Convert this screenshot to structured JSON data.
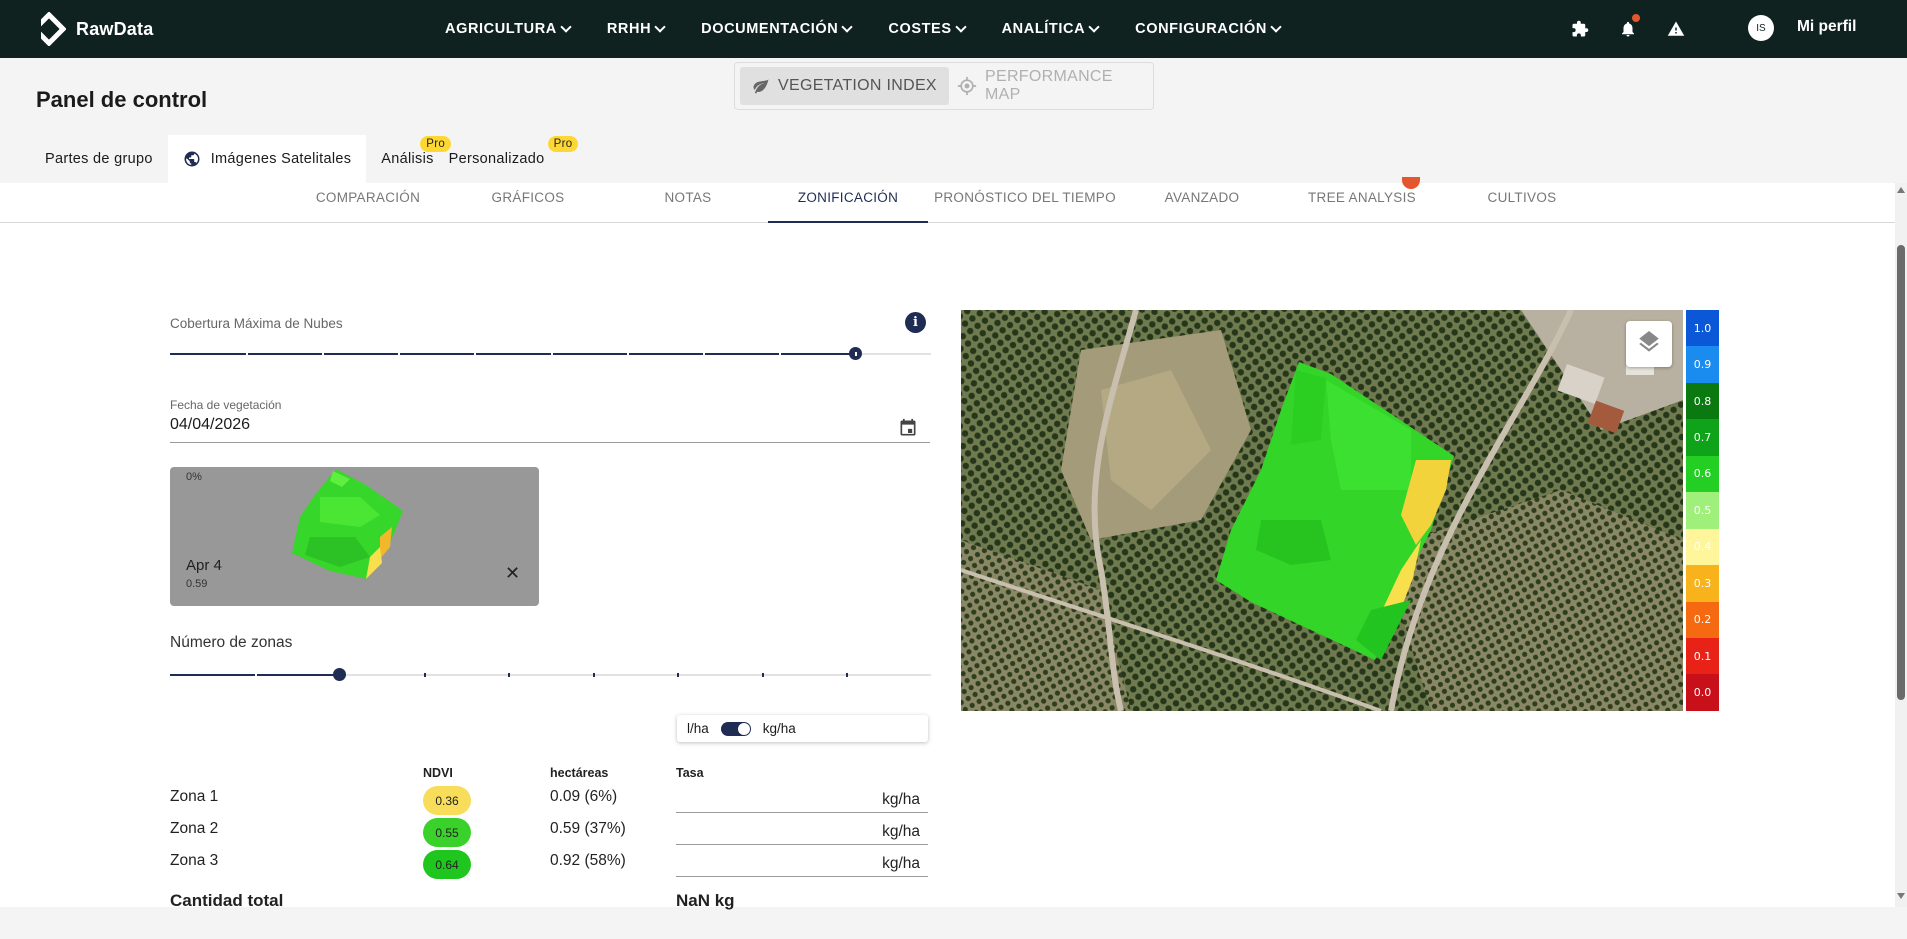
{
  "app": {
    "name": "RawData"
  },
  "nav": {
    "menu": [
      "AGRICULTURA",
      "RRHH",
      "DOCUMENTACIÓN",
      "COSTES",
      "ANALÍTICA",
      "CONFIGURACIÓN"
    ],
    "avatar_initials": "IS",
    "profile_label": "Mi perfil"
  },
  "page": {
    "title": "Panel de control"
  },
  "tabs": [
    {
      "label": "Partes de grupo"
    },
    {
      "label": "Imágenes Satelitales",
      "icon": "globe-icon",
      "active": true
    },
    {
      "label": "Análisis",
      "badge": "Pro"
    },
    {
      "label": "Personalizado",
      "badge": "Pro"
    }
  ],
  "subtabs": [
    "COMPARACIÓN",
    "GRÁFICOS",
    "NOTAS",
    "ZONIFICACIÓN",
    "PRONÓSTICO DEL TIEMPO",
    "AVANZADO",
    "TREE ANALYSIS",
    "CULTIVOS"
  ],
  "active_subtab": "ZONIFICACIÓN",
  "mode_toggle": {
    "vegetation": "VEGETATION INDEX",
    "performance": "PERFORMANCE MAP"
  },
  "controls": {
    "cloud_label": "Cobertura Máxima de Nubes",
    "cloud_value_fraction": 0.9,
    "date_label": "Fecha de vegetación",
    "date_value": "04/04/2026",
    "zones_label": "Número de zonas",
    "zones_value_fraction": 0.222
  },
  "thumbnail": {
    "cloud_pct": "0%",
    "date": "Apr 4",
    "value": "0.59"
  },
  "units": {
    "left": "l/ha",
    "right": "kg/ha"
  },
  "table": {
    "headers": {
      "ndvi": "NDVI",
      "hectares": "hectáreas",
      "rate": "Tasa"
    },
    "rows": [
      {
        "zone": "Zona 1",
        "ndvi": "0.36",
        "color": "#f7dd5a",
        "hectares": "0.09 (6%)",
        "unit": "kg/ha"
      },
      {
        "zone": "Zona 2",
        "ndvi": "0.55",
        "color": "#3ad12b",
        "hectares": "0.59 (37%)",
        "unit": "kg/ha"
      },
      {
        "zone": "Zona 3",
        "ndvi": "0.64",
        "color": "#1ec61e",
        "hectares": "0.92 (58%)",
        "unit": "kg/ha"
      }
    ],
    "total_label": "Cantidad total",
    "total_value": "NaN kg"
  },
  "legend": [
    {
      "label": "1.0",
      "color": "#0a58d8"
    },
    {
      "label": "0.9",
      "color": "#1a8cf0"
    },
    {
      "label": "0.8",
      "color": "#0a7a10"
    },
    {
      "label": "0.7",
      "color": "#0fa31a"
    },
    {
      "label": "0.6",
      "color": "#22cf22"
    },
    {
      "label": "0.5",
      "color": "#9ef07a"
    },
    {
      "label": "0.4",
      "color": "#fff59a"
    },
    {
      "label": "0.3",
      "color": "#f7b21c"
    },
    {
      "label": "0.2",
      "color": "#f56a10"
    },
    {
      "label": "0.1",
      "color": "#e92218"
    },
    {
      "label": "0.0",
      "color": "#c8101a"
    }
  ],
  "colors": {
    "nav_bg": "#0f2220",
    "accent": "#1f2d54",
    "pro_badge": "#fdd835",
    "notification": "#e4572e"
  }
}
